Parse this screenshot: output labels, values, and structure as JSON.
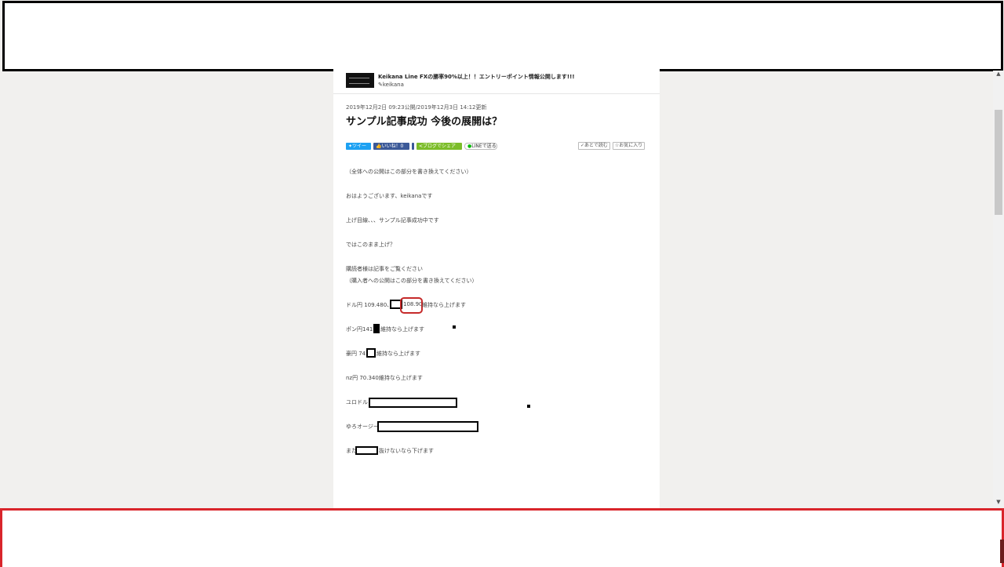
{
  "author": {
    "title": "Keikana Line FXの勝率90%以上！！エントリーポイント情報公開します!!!",
    "name_icon": "✎",
    "name": "keikana"
  },
  "article": {
    "dates": "2019年12月2日 09:23公開/2019年12月3日 14:12更新",
    "title": "サンプル記事成功 今後の展開は？"
  },
  "share": {
    "tweet": "ツイー",
    "like": "いいね！0",
    "hatena": "ブログでシェア",
    "line": "LINEで送る",
    "later": "あとで読む",
    "favorite": "お気に入り"
  },
  "body": {
    "p1": "（全体への公開はこの部分を書き換えてください）",
    "p2": "おはようございます、keikanaです",
    "p3": "上げ目線、、、サンプル記事成功中です",
    "p4": "ではこのまま上げ？",
    "p5": "購読者様は記事をご覧ください",
    "p6": "（購入者への公開はこの部分を書き換えてください）",
    "usdjpy_prefix": "ドル円  109.480、",
    "usdjpy_value": "108.90",
    "usdjpy_suffix": "維持なら上げます",
    "gbpjpy_prefix": "ポン円141.",
    "gbpjpy_suffix": "維持なら上げます",
    "audjpy_prefix": "豪円 74.",
    "audjpy_suffix": "維持なら上げます",
    "nzdjpy": "nz円 70.340維持なら上げます",
    "eurusd_prefix": "ユロドル",
    "euraud_prefix": "ゆろオージー",
    "last_prefix": "また",
    "last_suffix": "抜けないなら下げます"
  }
}
